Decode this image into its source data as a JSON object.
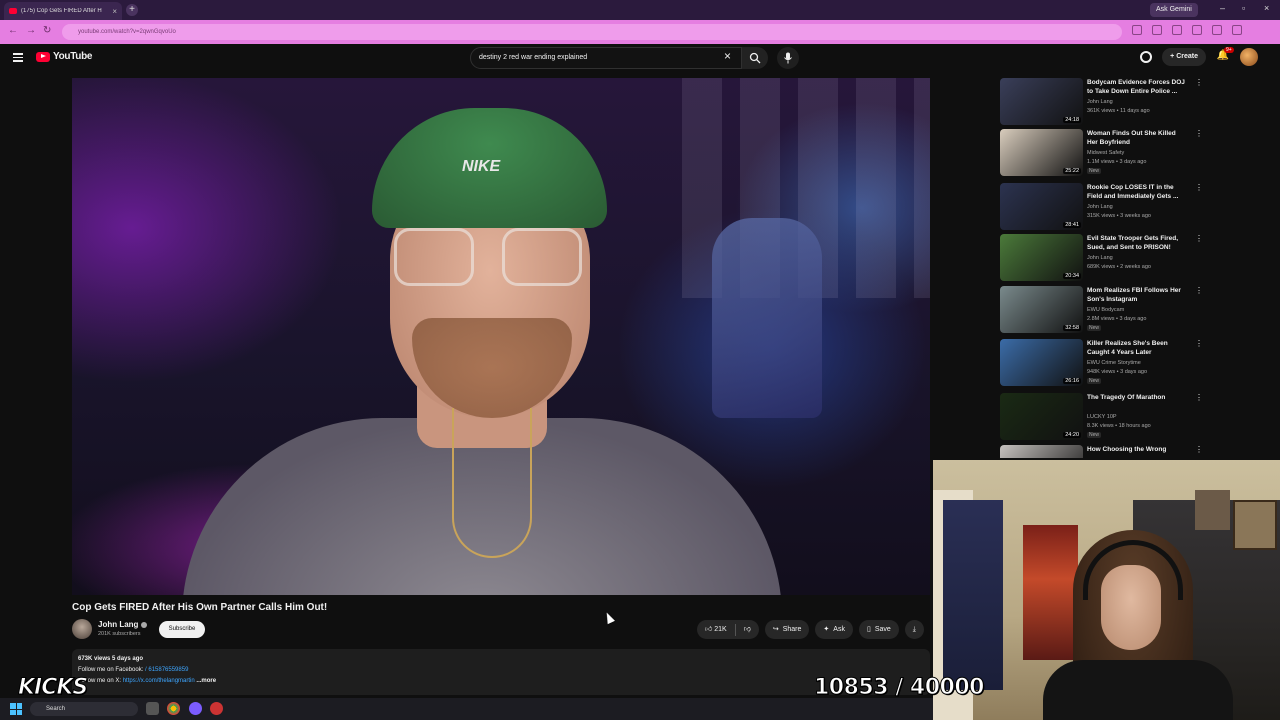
{
  "browser": {
    "tab_title": "(175) Cop Gets FIRED After H",
    "url": "youtube.com/watch?v=2qwnGqvoUo",
    "ask_gemini": "Ask Gemini"
  },
  "header": {
    "logo_text": "YouTube",
    "search_query": "destiny 2 red war ending explained",
    "create_label": "Create",
    "notification_count": "9+"
  },
  "player": {
    "cap_text": "NIKE"
  },
  "video": {
    "title": "Cop Gets FIRED After His Own Partner Calls Him Out!",
    "channel": "John Lang",
    "subscribers": "201K subscribers",
    "subscribe_label": "Subscribe",
    "likes": "21K",
    "share_label": "Share",
    "ask_label": "Ask",
    "save_label": "Save",
    "stats": "673K views  5 days ago",
    "desc_line1_prefix": "Follow me on Facebook: ",
    "desc_line1_link": "/ 615876559859",
    "desc_line2_prefix": "Follow me on X: ",
    "desc_line2_link": "https://x.com/thelangmartin",
    "more_label": "...more"
  },
  "recommendations": [
    {
      "title": "Bodycam Evidence Forces DOJ to Take Down Entire Police ...",
      "channel": "John Lang",
      "meta": "361K views • 11 days ago",
      "duration": "24:18",
      "new": "",
      "thumb_color": "#3a3f5a"
    },
    {
      "title": "Woman Finds Out She Killed Her Boyfriend",
      "channel": "Midwest Safety",
      "meta": "1.1M views • 3 days ago",
      "duration": "25:22",
      "new": "New",
      "thumb_color": "#d9cdbd"
    },
    {
      "title": "Rookie Cop LOSES IT in the Field and Immediately Gets ...",
      "channel": "John Lang",
      "meta": "315K views • 3 weeks ago",
      "duration": "28:41",
      "new": "",
      "thumb_color": "#2c3350"
    },
    {
      "title": "Evil State Trooper Gets Fired, Sued, and Sent to PRISON!",
      "channel": "John Lang",
      "meta": "689K views • 2 weeks ago",
      "duration": "20:34",
      "new": "",
      "thumb_color": "#4b7a3a"
    },
    {
      "title": "Mom Realizes FBI Follows Her Son's Instagram",
      "channel": "EWU Bodycam",
      "meta": "2.8M views • 3 days ago",
      "duration": "32:58",
      "new": "New",
      "thumb_color": "#7a8a8c"
    },
    {
      "title": "Killer Realizes She's Been Caught 4 Years Later",
      "channel": "EWU Crime Storytime",
      "meta": "948K views • 3 days ago",
      "duration": "26:16",
      "new": "New",
      "thumb_color": "#3b6ca8"
    },
    {
      "title": "The Tragedy Of Marathon",
      "channel": "LUCKY 10P",
      "meta": "8.3K views • 18 hours ago",
      "duration": "24:20",
      "new": "New",
      "thumb_color": "#1a2a14"
    },
    {
      "title": "How Choosing the Wrong",
      "channel": "",
      "meta": "",
      "duration": "",
      "new": "",
      "thumb_color": "#c7c2bf"
    }
  ],
  "overlay": {
    "kicks": "KICKS",
    "counter": "10853 / 40000"
  },
  "taskbar": {
    "search_label": "Search"
  }
}
